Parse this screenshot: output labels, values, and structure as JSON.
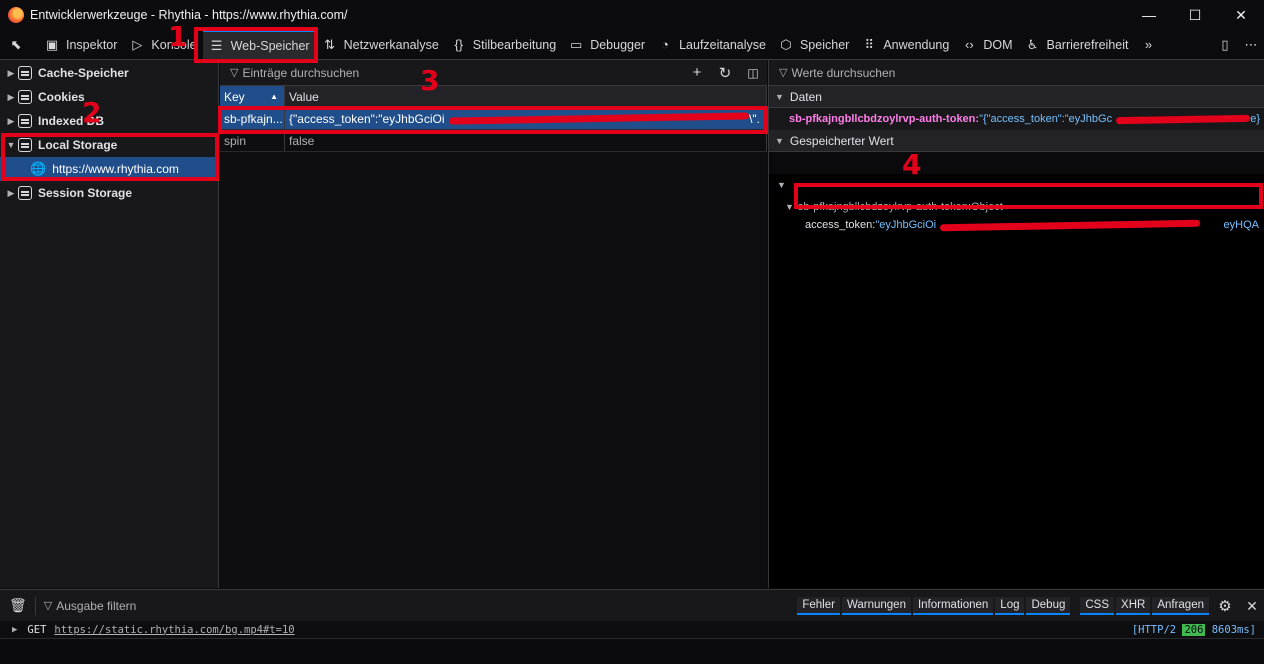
{
  "window": {
    "title": "Entwicklerwerkzeuge - Rhythia - https://www.rhythia.com/",
    "controls": [
      "—",
      "☐",
      "✕"
    ]
  },
  "tabs": [
    {
      "label": "Inspektor",
      "icon": "inspector-icon"
    },
    {
      "label": "Konsole",
      "icon": "console-icon"
    },
    {
      "label": "Web-Speicher",
      "icon": "storage-icon"
    },
    {
      "label": "Netzwerkanalyse",
      "icon": "network-icon"
    },
    {
      "label": "Stilbearbeitung",
      "icon": "style-editor-icon"
    },
    {
      "label": "Debugger",
      "icon": "debugger-icon"
    },
    {
      "label": "Laufzeitanalyse",
      "icon": "performance-icon"
    },
    {
      "label": "Speicher",
      "icon": "memory-icon"
    },
    {
      "label": "Anwendung",
      "icon": "application-icon"
    },
    {
      "label": "DOM",
      "icon": "dom-icon"
    },
    {
      "label": "Barrierefreiheit",
      "icon": "accessibility-icon"
    }
  ],
  "active_tab": "Web-Speicher",
  "sidebar": {
    "items": [
      {
        "label": "Cache-Speicher",
        "expanded": false
      },
      {
        "label": "Cookies",
        "expanded": false
      },
      {
        "label": "Indexed DB",
        "expanded": false
      },
      {
        "label": "Local Storage",
        "expanded": true
      },
      {
        "label": "Session Storage",
        "expanded": false
      }
    ],
    "local_storage_child": "https://www.rhythia.com"
  },
  "table": {
    "filter_placeholder": "Einträge durchsuchen",
    "columns": [
      "Key",
      "Value"
    ],
    "rows": [
      {
        "key": "sb-pfkajn...",
        "value": "{\"access_token\":\"eyJhbGciOi",
        "value_tail": "\\\".",
        "selected": true
      },
      {
        "key": "spin",
        "value": "false",
        "selected": false
      }
    ]
  },
  "details": {
    "filter_placeholder": "Werte durchsuchen",
    "data_header": "Daten",
    "data_key": "sb-pfkajngbllcbdzoylrvp-auth-token:",
    "data_value": "\"{\"access_token\":\"eyJhbGc",
    "data_tail": "e}",
    "stored_header": "Gespeicherter Wert",
    "object_label": "sb-pfkajngbllcbdzoylrvp-auth-token:Object",
    "access_token_label": "access_token:",
    "access_token_value": "\"eyJhbGciOi",
    "access_token_tail": "eyHQA"
  },
  "annotations": [
    "1",
    "2",
    "3",
    "4"
  ],
  "console": {
    "filter_placeholder": "Ausgabe filtern",
    "filters": [
      "Fehler",
      "Warnungen",
      "Informationen",
      "Log",
      "Debug",
      "CSS",
      "XHR",
      "Anfragen"
    ],
    "log": {
      "method": "GET",
      "url": "https://static.rhythia.com/bg.mp4#t=10",
      "protocol": "[HTTP/2",
      "status": "206",
      "time": "8603ms]"
    }
  },
  "colors": {
    "accent": "#0a84ff",
    "annotation": "#e3001b",
    "selection": "#204e8a",
    "key_pink": "#ff7de9",
    "value_blue": "#75bfff"
  }
}
